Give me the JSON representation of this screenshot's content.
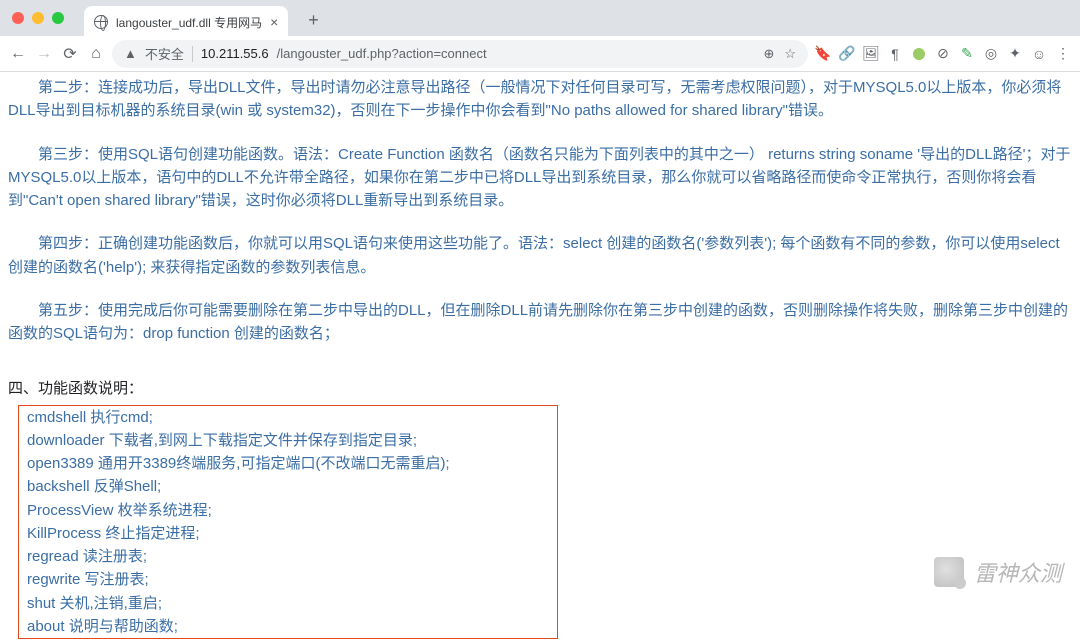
{
  "tab": {
    "title": "langouster_udf.dll 专用网马"
  },
  "toolbar": {
    "insecure_label": "不安全",
    "url_ip": "10.211.55.6",
    "url_path": "/langouster_udf.php?action=connect"
  },
  "content": {
    "step2": "第二步：连接成功后，导出DLL文件，导出时请勿必注意导出路径（一般情况下对任何目录可写，无需考虑权限问题），对于MYSQL5.0以上版本，你必须将DLL导出到目标机器的系统目录(win 或 system32)，否则在下一步操作中你会看到\"No paths allowed for shared library\"错误。",
    "step3": "第三步：使用SQL语句创建功能函数。语法：Create Function 函数名（函数名只能为下面列表中的其中之一） returns string soname '导出的DLL路径'；对于MYSQL5.0以上版本，语句中的DLL不允许带全路径，如果你在第二步中已将DLL导出到系统目录，那么你就可以省略路径而使命令正常执行，否则你将会看到\"Can't open shared library\"错误，这时你必须将DLL重新导出到系统目录。",
    "step4": "第四步：正确创建功能函数后，你就可以用SQL语句来使用这些功能了。语法：select 创建的函数名('参数列表');   每个函数有不同的参数，你可以使用select 创建的函数名('help');  来获得指定函数的参数列表信息。",
    "step5": "第五步：使用完成后你可能需要删除在第二步中导出的DLL，但在删除DLL前请先删除你在第三步中创建的函数，否则删除操作将失败，删除第三步中创建的函数的SQL语句为：drop function 创建的函数名；",
    "section4_title": "四、功能函数说明：",
    "funcs": [
      "cmdshell 执行cmd;",
      "downloader 下载者,到网上下载指定文件并保存到指定目录;",
      "open3389 通用开3389终端服务,可指定端口(不改端口无需重启);",
      "backshell 反弹Shell;",
      "ProcessView 枚举系统进程;",
      "KillProcess 终止指定进程;",
      "regread 读注册表;",
      "regwrite 写注册表;",
      "shut 关机,注销,重启;",
      "about 说明与帮助函数;"
    ]
  },
  "watermark": {
    "text": "雷神众测"
  }
}
